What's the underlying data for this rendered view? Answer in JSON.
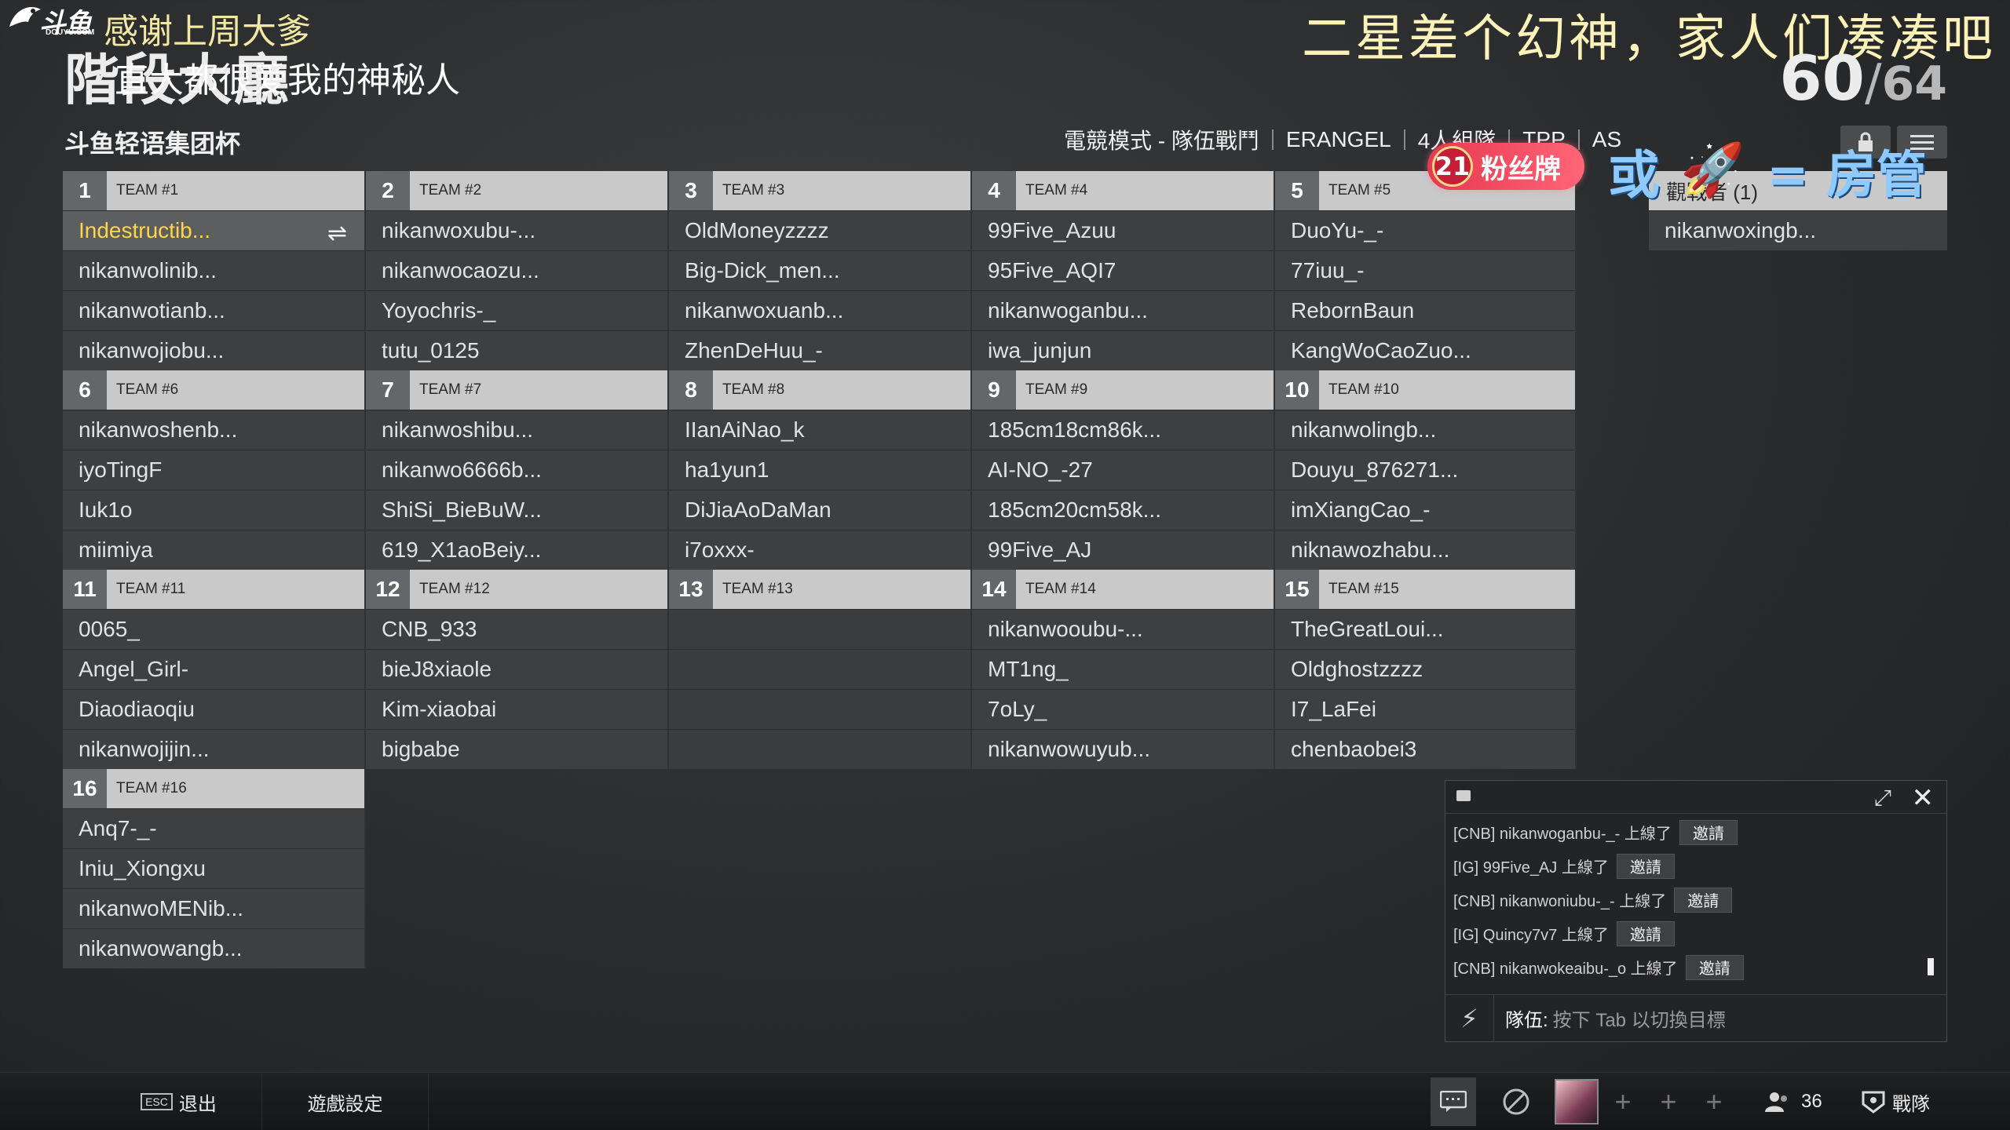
{
  "overlay": {
    "logo_text": "斗鱼",
    "logo_url": "DOUYU.COM",
    "thanks_line1": "感谢上周大爹",
    "thanks_line2": "直大都很爱我的神秘人",
    "top_right_banner": "二星差个幻神，家人们凑凑吧",
    "fan_badge_level": "21",
    "fan_badge_label": "粉丝牌",
    "or_text": "或",
    "rocket_icon": "rocket-icon",
    "room_admin_text": "= 房管"
  },
  "header": {
    "phase_title": "階段大廳",
    "players_current": "60",
    "players_max": "64",
    "room_name": "斗鱼轻语集团杯",
    "mode_items": [
      "電競模式 - 隊伍戰鬥",
      "ERANGEL",
      "4人組隊",
      "TPP",
      "AS"
    ]
  },
  "teams": [
    {
      "num": "1",
      "name": "TEAM #1",
      "players": [
        "Indestructib...",
        "nikanwolinib...",
        "nikanwotianb...",
        "nikanwojiobu..."
      ]
    },
    {
      "num": "2",
      "name": "TEAM #2",
      "players": [
        "nikanwoxubu-...",
        "nikanwocaozu...",
        "Yoyochris-_",
        "tutu_0125"
      ]
    },
    {
      "num": "3",
      "name": "TEAM #3",
      "players": [
        "OldMoneyzzzz",
        "Big-Dick_men...",
        "nikanwoxuanb...",
        "ZhenDeHuu_-"
      ]
    },
    {
      "num": "4",
      "name": "TEAM #4",
      "players": [
        "99Five_Azuu",
        "95Five_AQI7",
        "nikanwoganbu...",
        "iwa_junjun"
      ]
    },
    {
      "num": "5",
      "name": "TEAM #5",
      "players": [
        "DuoYu-_-",
        "77iuu_-",
        "RebornBaun",
        "KangWoCaoZuo..."
      ]
    },
    {
      "num": "6",
      "name": "TEAM #6",
      "players": [
        "nikanwoshenb...",
        "iyoTingF",
        "Iuk1o",
        "miimiya"
      ]
    },
    {
      "num": "7",
      "name": "TEAM #7",
      "players": [
        "nikanwoshibu...",
        "nikanwo6666b...",
        "ShiSi_BieBuW...",
        "619_X1aoBeiy..."
      ]
    },
    {
      "num": "8",
      "name": "TEAM #8",
      "players": [
        "IIanAiNao_k",
        "ha1yun1",
        "DiJiaAoDaMan",
        "i7oxxx-"
      ]
    },
    {
      "num": "9",
      "name": "TEAM #9",
      "players": [
        "185cm18cm86k...",
        "AI-NO_-27",
        "185cm20cm58k...",
        "99Five_AJ"
      ]
    },
    {
      "num": "10",
      "name": "TEAM #10",
      "players": [
        "nikanwolingb...",
        "Douyu_876271...",
        "imXiangCao_-",
        "niknawozhabu..."
      ]
    },
    {
      "num": "11",
      "name": "TEAM #11",
      "players": [
        "0065_",
        "Angel_Girl-",
        "Diaodiaoqiu",
        "nikanwojijin..."
      ]
    },
    {
      "num": "12",
      "name": "TEAM #12",
      "players": [
        "CNB_933",
        "bieJ8xiaole",
        "Kim-xiaobai",
        "bigbabe"
      ]
    },
    {
      "num": "13",
      "name": "TEAM #13",
      "players": [
        "",
        "",
        "",
        ""
      ]
    },
    {
      "num": "14",
      "name": "TEAM #14",
      "players": [
        "nikanwooubu-...",
        "MT1ng_",
        "7oLy_",
        "nikanwowuyub..."
      ]
    },
    {
      "num": "15",
      "name": "TEAM #15",
      "players": [
        "TheGreatLoui...",
        "Oldghostzzzz",
        "I7_LaFei",
        "chenbaobei3"
      ]
    },
    {
      "num": "16",
      "name": "TEAM #16",
      "players": [
        "Anq7-_-",
        "Iniu_Xiongxu",
        "nikanwoMENib...",
        "nikanwowangb..."
      ]
    }
  ],
  "spectators": {
    "header": "觀戰者 (1)",
    "players": [
      "nikanwoxingb..."
    ]
  },
  "chat": {
    "messages": [
      {
        "text": "[CNB] nikanwoganbu-_- 上線了",
        "invite": "邀請"
      },
      {
        "text": "[IG] 99Five_AJ 上線了",
        "invite": "邀請"
      },
      {
        "text": "[CNB] nikanwoniubu-_- 上線了",
        "invite": "邀請"
      },
      {
        "text": "[IG] Quincy7v7 上線了",
        "invite": "邀請"
      },
      {
        "text": "[CNB] nikanwokeaibu-_o 上線了",
        "invite": "邀請"
      }
    ],
    "channel": "隊伍:",
    "placeholder": "按下 Tab 以切換目標"
  },
  "bottom_bar": {
    "esc_key": "ESC",
    "exit_label": "退出",
    "settings_label": "遊戲設定",
    "friends_count": "36",
    "spectate_label": "戰隊"
  }
}
